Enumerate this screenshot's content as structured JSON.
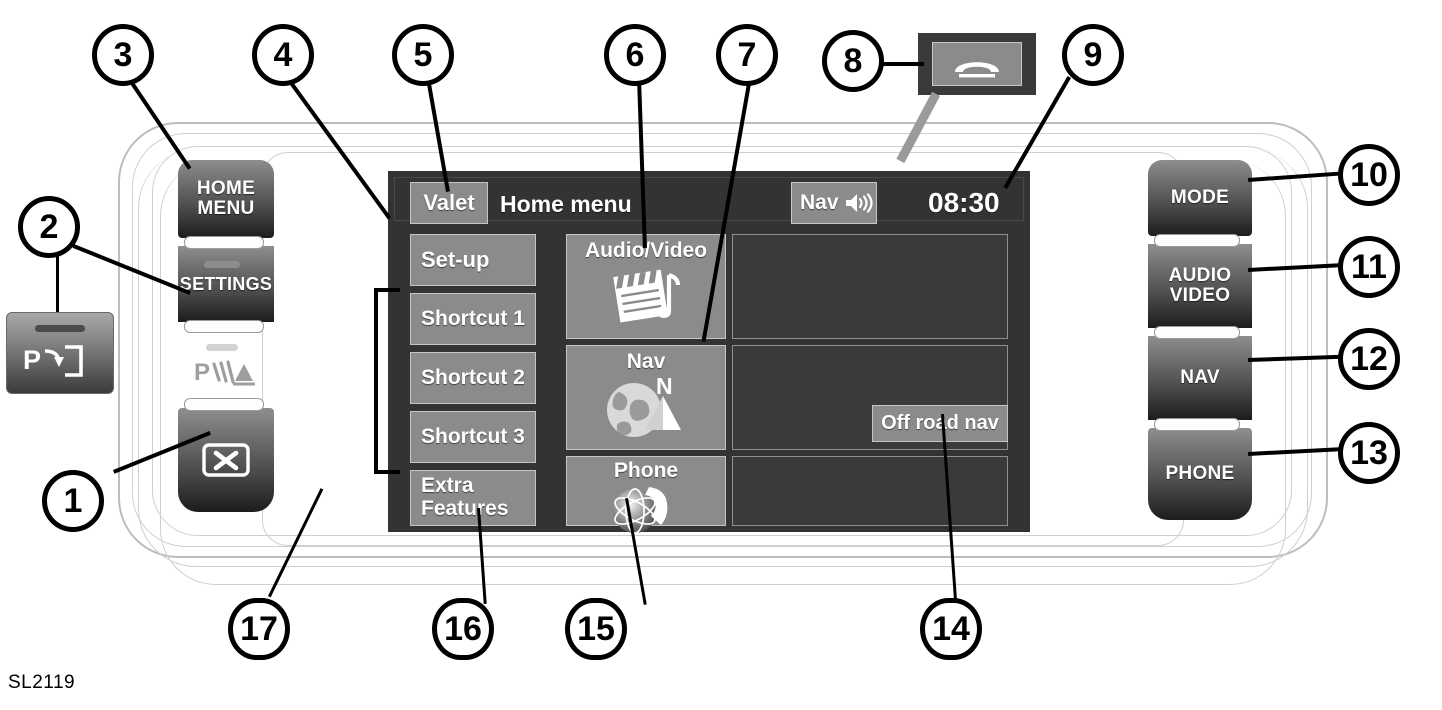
{
  "figure": {
    "reference": "SL2119"
  },
  "callouts": [
    {
      "id": "1",
      "label": "1"
    },
    {
      "id": "2",
      "label": "2"
    },
    {
      "id": "3",
      "label": "3"
    },
    {
      "id": "4",
      "label": "4"
    },
    {
      "id": "5",
      "label": "5"
    },
    {
      "id": "6",
      "label": "6"
    },
    {
      "id": "7",
      "label": "7"
    },
    {
      "id": "8",
      "label": "8"
    },
    {
      "id": "9",
      "label": "9"
    },
    {
      "id": "10",
      "label": "10"
    },
    {
      "id": "11",
      "label": "11"
    },
    {
      "id": "12",
      "label": "12"
    },
    {
      "id": "13",
      "label": "13"
    },
    {
      "id": "14",
      "label": "14"
    },
    {
      "id": "15",
      "label": "15"
    },
    {
      "id": "16",
      "label": "16"
    },
    {
      "id": "17",
      "label": "17"
    }
  ],
  "left_buttons": {
    "home_menu": "HOME\nMENU",
    "home_menu_line1": "HOME",
    "home_menu_line2": "MENU",
    "settings": "SETTINGS",
    "park_sensor_icon": "parking-distance-icon",
    "close": "close-x-icon"
  },
  "park_button": {
    "icon": "park-assist-icon",
    "letter": "P"
  },
  "phone_inset": {
    "icon": "phone-handset-icon"
  },
  "right_buttons": {
    "mode": "MODE",
    "audio_video_line1": "AUDIO",
    "audio_video_line2": "VIDEO",
    "nav": "NAV",
    "phone": "PHONE"
  },
  "screen": {
    "status": {
      "valet": "Valet",
      "title": "Home menu",
      "nav_audio": "Nav",
      "nav_audio_icon": "speaker-volume-icon",
      "clock": "08:30"
    },
    "side_menu": [
      {
        "label": "Set-up",
        "name": "setup"
      },
      {
        "label": "Shortcut 1",
        "name": "shortcut-1"
      },
      {
        "label": "Shortcut 2",
        "name": "shortcut-2"
      },
      {
        "label": "Shortcut 3",
        "name": "shortcut-3"
      },
      {
        "label": "Extra\nFeatures",
        "line1": "Extra",
        "line2": "Features",
        "name": "extra-features"
      }
    ],
    "tiles": [
      {
        "label": "Audio/Video",
        "icon": "clapperboard-music-icon",
        "name": "audio-video"
      },
      {
        "label": "Nav",
        "icon": "globe-compass-icon",
        "name": "nav"
      },
      {
        "label": "Phone",
        "icon": "globe-handset-icon",
        "name": "phone"
      }
    ],
    "overlay_button": {
      "label": "Off road nav",
      "name": "off-road-nav"
    }
  },
  "colors": {
    "screen_bg": "#333333",
    "key_fill": "#8b8b8b",
    "key_border": "#c6c6c6",
    "panel_fill": "#3a3a3a",
    "panel_border": "#8f8f8f",
    "text": "#ffffff",
    "surround": "#bdbdbd"
  }
}
